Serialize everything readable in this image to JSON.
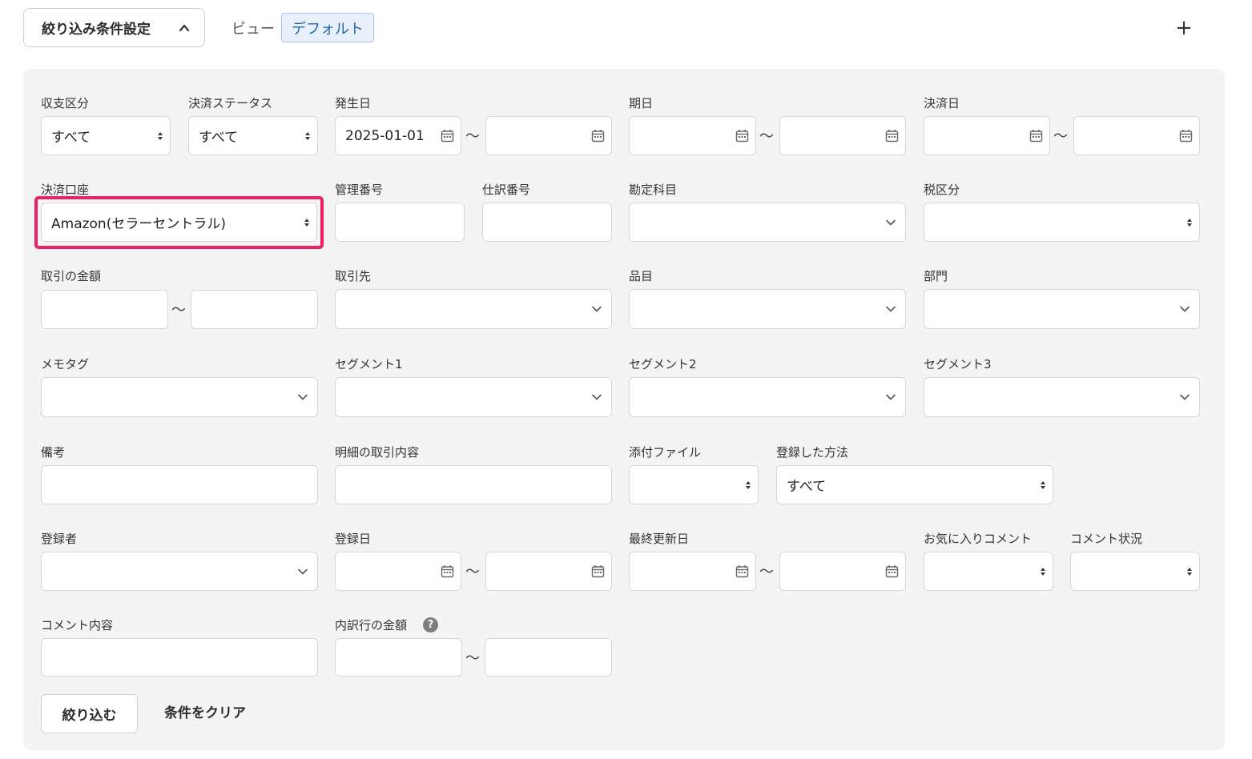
{
  "header": {
    "toggle_label": "絞り込み条件設定",
    "view_label": "ビュー",
    "view_value": "デフォルト",
    "add_symbol": "+"
  },
  "range_separator": "〜",
  "filters": {
    "income_type": {
      "label": "収支区分",
      "value": "すべて"
    },
    "settlement_status": {
      "label": "決済ステータス",
      "value": "すべて"
    },
    "issue_date": {
      "label": "発生日",
      "from": "2025-01-01",
      "to": ""
    },
    "due_date": {
      "label": "期日"
    },
    "settlement_date": {
      "label": "決済日"
    },
    "settlement_account": {
      "label": "決済口座",
      "value": "Amazon(セラーセントラル)"
    },
    "management_number": {
      "label": "管理番号"
    },
    "journal_number": {
      "label": "仕訳番号"
    },
    "account_item": {
      "label": "勘定科目"
    },
    "tax_category": {
      "label": "税区分"
    },
    "amount": {
      "label": "取引の金額"
    },
    "partner": {
      "label": "取引先"
    },
    "item": {
      "label": "品目"
    },
    "department": {
      "label": "部門"
    },
    "memo_tag": {
      "label": "メモタグ"
    },
    "segment1": {
      "label": "セグメント1"
    },
    "segment2": {
      "label": "セグメント2"
    },
    "segment3": {
      "label": "セグメント3"
    },
    "remarks": {
      "label": "備考"
    },
    "detail_description": {
      "label": "明細の取引内容"
    },
    "attachment": {
      "label": "添付ファイル"
    },
    "registration_method": {
      "label": "登録した方法",
      "value": "すべて"
    },
    "registrant": {
      "label": "登録者"
    },
    "registration_date": {
      "label": "登録日"
    },
    "last_updated": {
      "label": "最終更新日"
    },
    "favorite_comment": {
      "label": "お気に入りコメント"
    },
    "comment_status": {
      "label": "コメント状況"
    },
    "comment_content": {
      "label": "コメント内容"
    },
    "breakdown_amount": {
      "label": "内訳行の金額",
      "help": "?"
    }
  },
  "actions": {
    "submit_label": "絞り込む",
    "clear_label": "条件をクリア"
  },
  "colors": {
    "highlight": "#ee1f64",
    "chip_bg": "#e7f0fb",
    "chip_text": "#2466a8",
    "panel_bg": "#f5f4f5"
  }
}
